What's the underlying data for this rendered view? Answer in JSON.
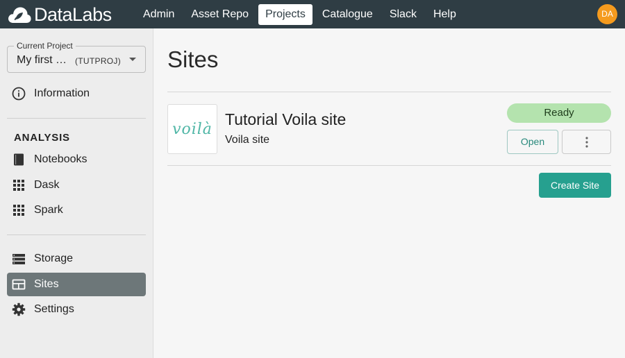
{
  "brand": {
    "name": "DataLabs",
    "logo_icon": "cloud-icon"
  },
  "nav": {
    "items": [
      "Admin",
      "Asset Repo",
      "Projects",
      "Catalogue",
      "Slack",
      "Help"
    ],
    "active": "Projects"
  },
  "user": {
    "initials": "DA",
    "avatar_color": "#f59b1e"
  },
  "sidebar": {
    "project_select": {
      "label": "Current Project",
      "value": "My first …",
      "code": "(TUTPROJ)"
    },
    "information": {
      "label": "Information",
      "icon": "info-icon"
    },
    "analysis_title": "ANALYSIS",
    "analysis_items": [
      {
        "label": "Notebooks",
        "icon": "notebook-icon"
      },
      {
        "label": "Dask",
        "icon": "grid-icon"
      },
      {
        "label": "Spark",
        "icon": "grid-icon"
      }
    ],
    "other_items": [
      {
        "label": "Storage",
        "icon": "storage-icon"
      },
      {
        "label": "Sites",
        "icon": "web-icon",
        "active": true
      },
      {
        "label": "Settings",
        "icon": "gear-icon"
      }
    ]
  },
  "main": {
    "title": "Sites",
    "sites": [
      {
        "logo_text": "voilà",
        "name": "Tutorial Voila site",
        "type": "Voila site",
        "status": "Ready",
        "open_label": "Open",
        "more_icon": "more-vertical-icon"
      }
    ],
    "create_label": "Create Site"
  },
  "colors": {
    "topbar": "#2f3d44",
    "accent": "#26a08f",
    "status_ready": "#b4e3ae",
    "sidebar_active": "#6d7779"
  }
}
